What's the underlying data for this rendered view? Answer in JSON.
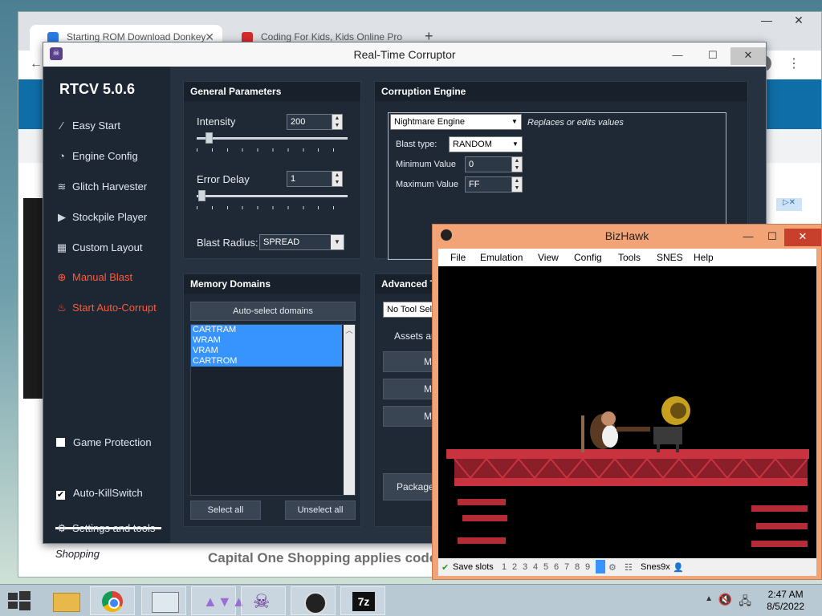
{
  "browser": {
    "tabs": [
      {
        "label": "Starting ROM Download Donkey",
        "favicon_color": "#2c7be5"
      },
      {
        "label": "Coding For Kids, Kids Online Pro",
        "favicon_color": "#d62b2b"
      }
    ],
    "new_tab": "+",
    "page_shopping": "Shopping",
    "page_promo": "Capital One Shopping applies code"
  },
  "rtcv": {
    "window_title": "Real-Time Corruptor",
    "version": "RTCV 5.0.6",
    "sidebar": {
      "items": [
        {
          "label": "Easy Start",
          "icon": "magic-wand-icon"
        },
        {
          "label": "Engine Config",
          "icon": "gauge-icon"
        },
        {
          "label": "Glitch Harvester",
          "icon": "layers-icon"
        },
        {
          "label": "Stockpile Player",
          "icon": "play-icon"
        },
        {
          "label": "Custom Layout",
          "icon": "grid-icon"
        },
        {
          "label": "Manual Blast",
          "icon": "crosshair-icon"
        },
        {
          "label": "Start Auto-Corrupt",
          "icon": "flame-icon"
        }
      ],
      "game_protection": "Game Protection",
      "auto_killswitch": "Auto-KillSwitch",
      "settings": "Settings and tools"
    },
    "general": {
      "header": "General Parameters",
      "intensity_label": "Intensity",
      "intensity_value": "200",
      "error_delay_label": "Error Delay",
      "error_delay_value": "1",
      "blast_radius_label": "Blast Radius:",
      "blast_radius_value": "SPREAD"
    },
    "engine": {
      "header": "Corruption Engine",
      "engine_value": "Nightmare Engine",
      "hint": "Replaces or edits values",
      "blast_type_label": "Blast type:",
      "blast_type_value": "RANDOM",
      "min_label": "Minimum Value",
      "min_value": "0",
      "max_label": "Maximum Value",
      "max_value": "FF"
    },
    "memory": {
      "header": "Memory Domains",
      "auto_select": "Auto-select domains",
      "domains": [
        "CARTRAM",
        "WRAM",
        "VRAM",
        "CARTROM"
      ],
      "select_all": "Select all",
      "unselect_all": "Unselect all"
    },
    "advanced": {
      "header": "Advanced To",
      "tool_select": "No Tool Sel",
      "assets": "Assets ar",
      "btn1": "M",
      "btn2": "My",
      "btn3": "My",
      "package": "Package"
    }
  },
  "bizhawk": {
    "title": "BizHawk",
    "menu": [
      "File",
      "Emulation",
      "View",
      "Config",
      "Tools",
      "SNES",
      "Help"
    ],
    "status": {
      "save_slots": "Save slots",
      "slots": [
        "1",
        "2",
        "3",
        "4",
        "5",
        "6",
        "7",
        "8",
        "9"
      ],
      "core": "Snes9x"
    }
  },
  "taskbar": {
    "time": "2:47 AM",
    "date": "8/5/2022",
    "apps": [
      "file-explorer-icon",
      "chrome-icon",
      "task-manager-icon",
      "rtcv-triangles-icon",
      "rtcv-skull-icon",
      "bizhawk-icon",
      "7zip-icon"
    ],
    "zip_label": "7z"
  }
}
